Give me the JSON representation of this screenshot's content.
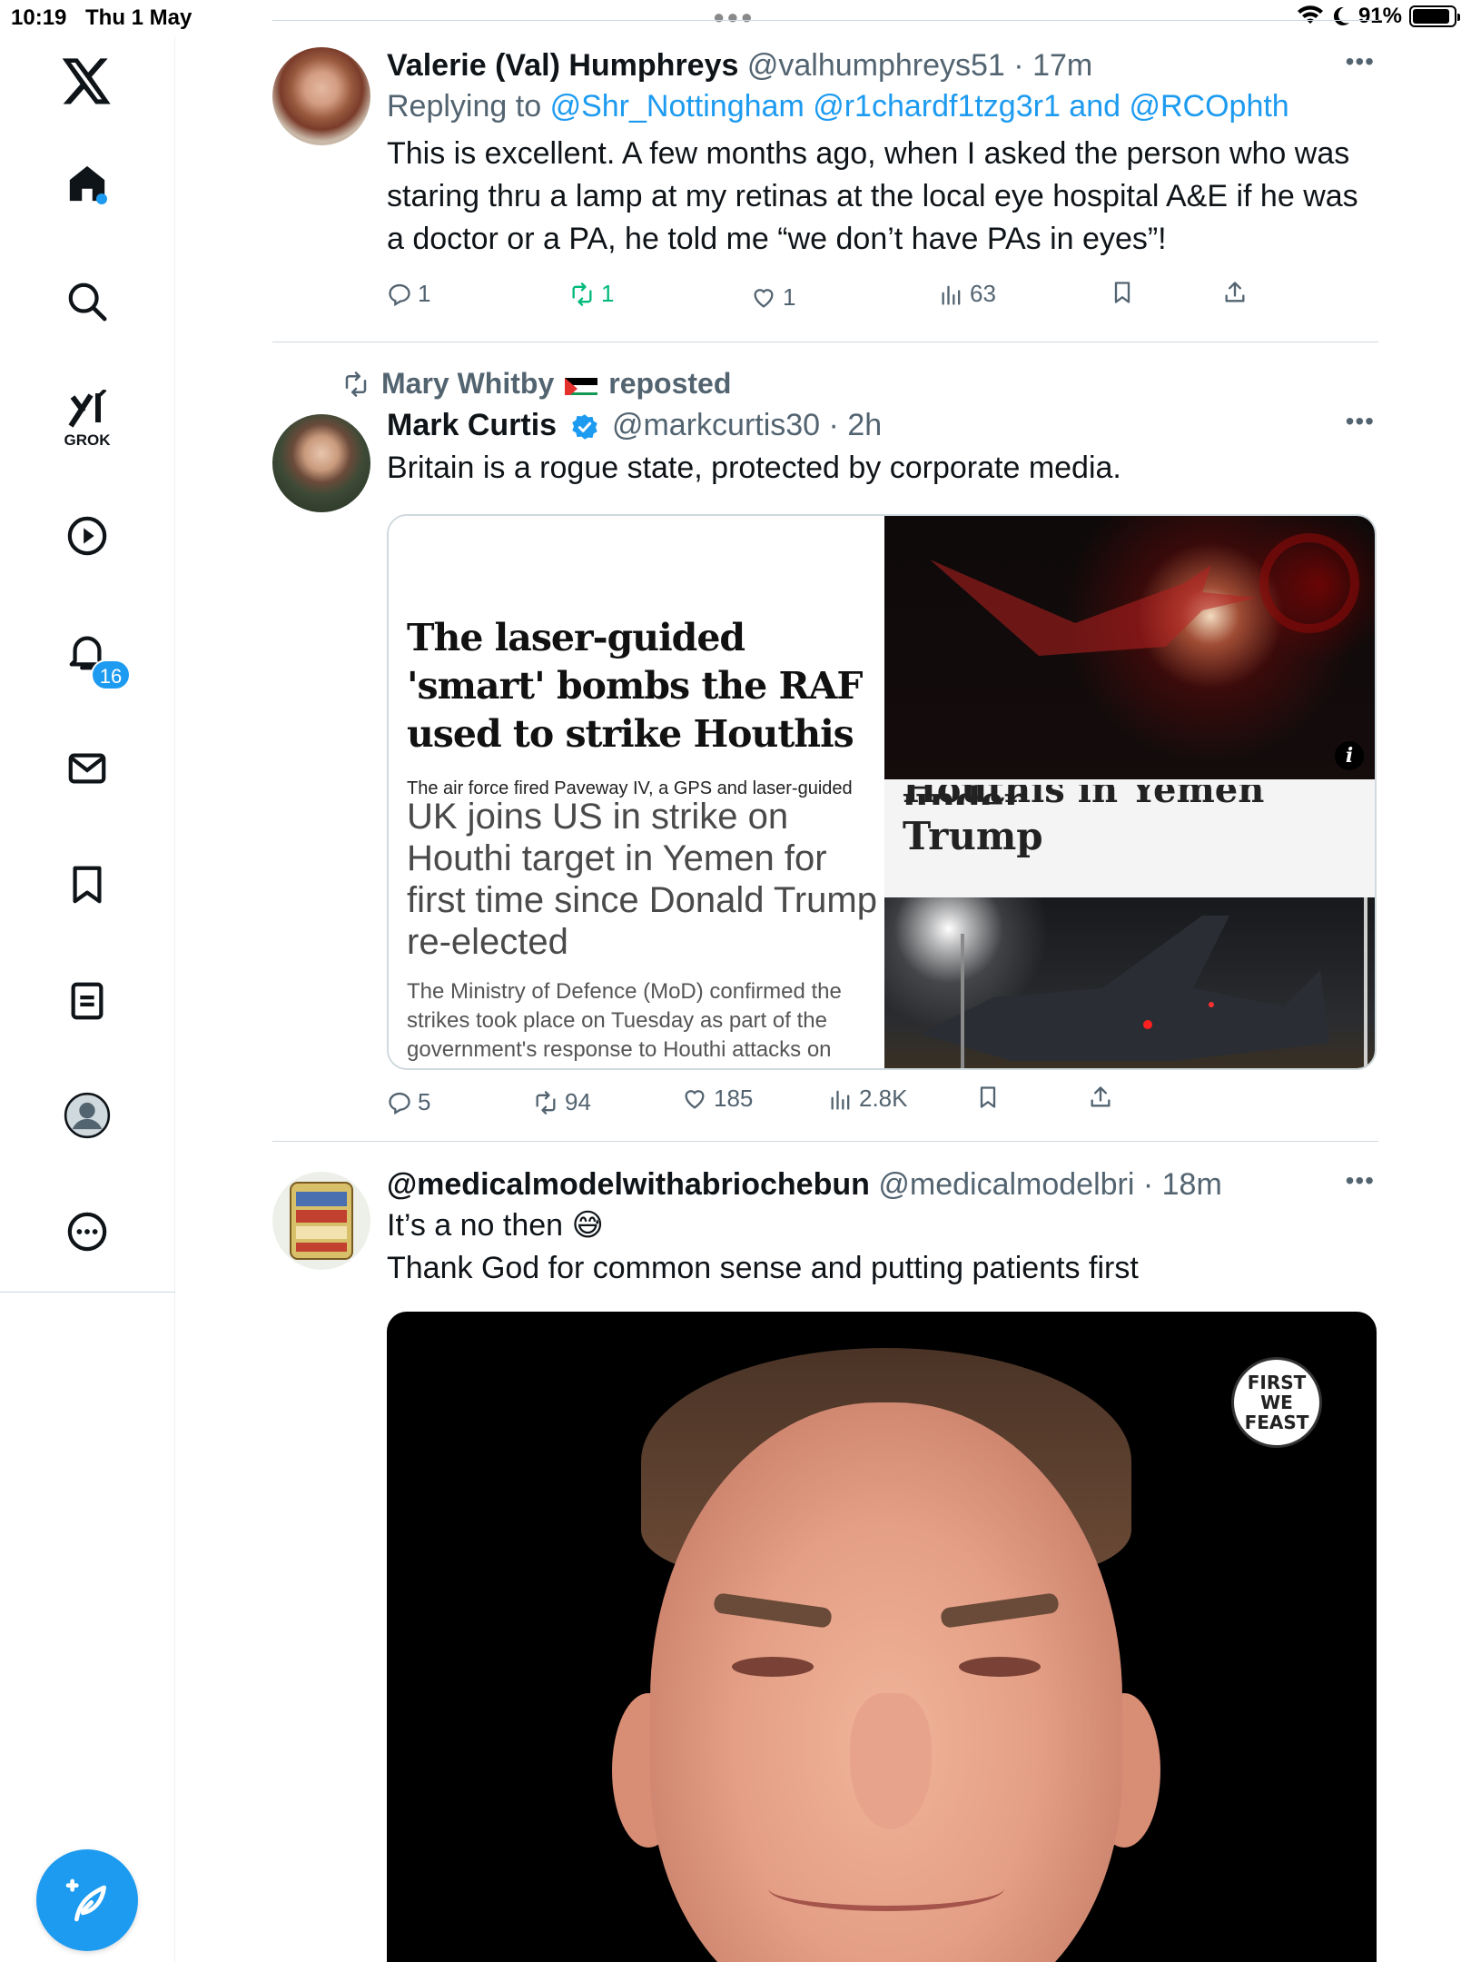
{
  "status_bar": {
    "time": "10:19",
    "date": "Thu 1 May",
    "battery": "91%",
    "battery_level": 0.91
  },
  "sidebar": {
    "items": [
      {
        "icon": "x-logo-icon"
      },
      {
        "icon": "home-icon"
      },
      {
        "icon": "search-icon"
      },
      {
        "icon": "grok-icon",
        "label": "GROK"
      },
      {
        "icon": "video-play-icon"
      },
      {
        "icon": "bell-icon",
        "badge": "16"
      },
      {
        "icon": "mail-icon"
      },
      {
        "icon": "bookmark-icon"
      },
      {
        "icon": "lists-icon"
      },
      {
        "icon": "profile-icon"
      },
      {
        "icon": "more-circle-icon"
      }
    ],
    "compose_icon": "compose-plus-feather-icon"
  },
  "tweets": [
    {
      "name": "Valerie (Val) Humphreys",
      "handle": "@valhumphreys51",
      "time": "17m",
      "replying_label": "Replying to",
      "replying_mentions": "@Shr_Nottingham @r1chardf1tzg3r1 and @RCOphth",
      "text": "This is excellent. A few months ago, when I asked the person who was staring thru a lamp at my retinas at the local eye hospital A&E if he was a doctor or a PA, he told me “we don’t have PAs in eyes”!",
      "replies": "1",
      "reposts": "1",
      "likes": "1",
      "views": "63"
    },
    {
      "repost_by": "Mary Whitby",
      "repost_label": "reposted",
      "name": "Mark Curtis",
      "handle": "@markcurtis30",
      "time": "2h",
      "text": "Britain is a rogue state, protected by corporate media.",
      "card": {
        "headline1": "The laser-guided 'smart' bombs the RAF used to strike Houthis",
        "sub1": "The air force fired Paveway IV, a GPS and laser-guided",
        "headline2": "UK joins US in strike on Houthi target in Yemen for first time since Donald Trump re-elected",
        "body2": "The Ministry of Defence (MoD) confirmed the strikes took place on Tuesday as part of the government's response to Houthi attacks on international shipping in the Red Sea and",
        "cut_line": "Houthis in Yemen under",
        "trump": "Trump",
        "info": "i"
      },
      "replies": "5",
      "reposts": "94",
      "likes": "185",
      "views": "2.8K"
    },
    {
      "name": "@medicalmodelwithabriochebun",
      "handle": "@medicalmodelbri",
      "time": "18m",
      "text_line1": "It’s a no then 😅",
      "text_line2": "Thank God for common sense and putting patients first",
      "gif_logo": "FIRST WE FEAST"
    }
  ],
  "colors": {
    "accent": "#1d9bf0",
    "repost_green": "#00ba7c",
    "secondary_text": "#536471",
    "divider": "#cfd9de"
  }
}
